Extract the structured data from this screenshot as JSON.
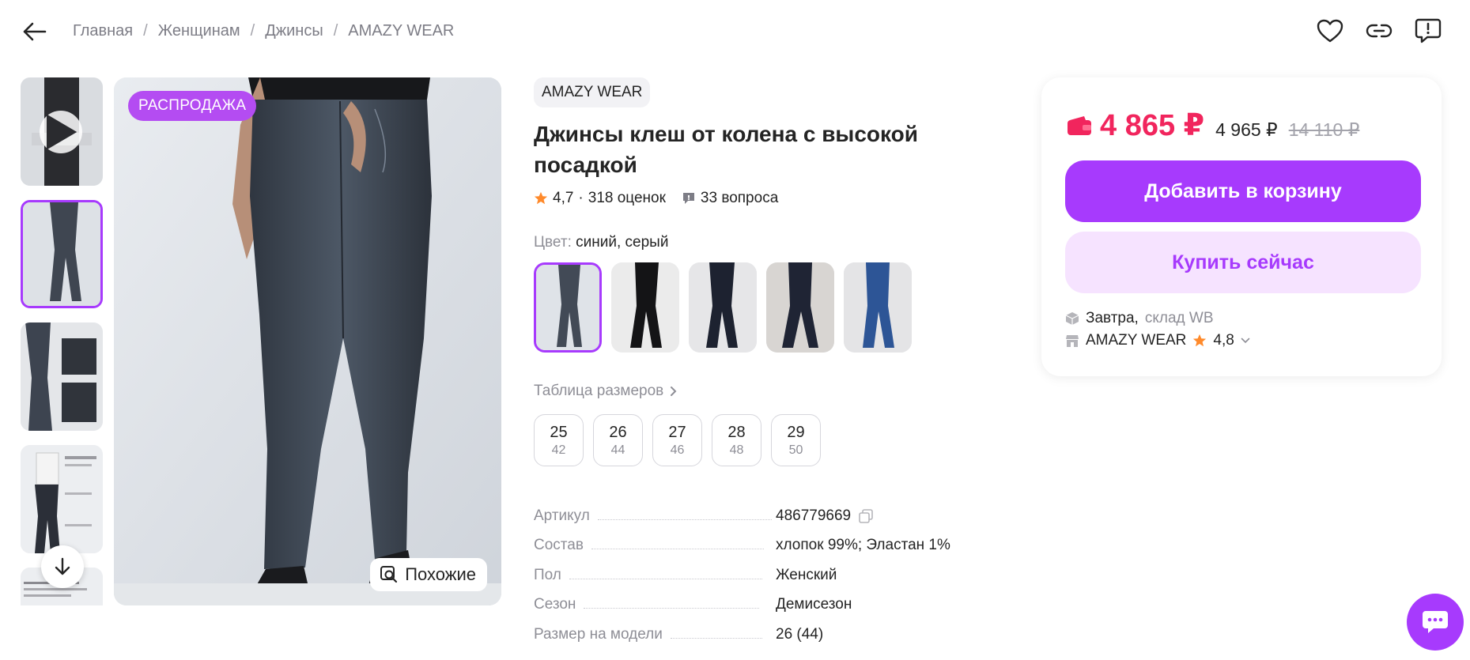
{
  "breadcrumb": {
    "items": [
      "Главная",
      "Женщинам",
      "Джинсы",
      "AMAZY WEAR"
    ],
    "separator": "/"
  },
  "icons": {
    "back": "arrow-left-icon",
    "favorite": "heart-icon",
    "share": "link-icon",
    "report": "report-icon",
    "play": "play-icon",
    "scroll_down": "arrow-down-icon",
    "similar": "similar-search-icon",
    "star": "star-icon",
    "questions": "chat-bubble-icon",
    "wallet": "wallet-icon",
    "copy": "copy-icon",
    "warehouse": "box-icon",
    "store": "store-icon",
    "chevron": "chevron-right-icon",
    "chat": "support-chat-icon"
  },
  "gallery": {
    "badge": "РАСПРОДАЖА",
    "similar_label": "Похожие"
  },
  "product": {
    "brand": "AMAZY WEAR",
    "title": "Джинсы клеш от колена с высокой посадкой",
    "rating": "4,7",
    "reviews": "318 оценок",
    "rating_sep": "·",
    "questions": "33 вопроса",
    "color_label": "Цвет:",
    "color_value": "синий, серый",
    "size_table_label": "Таблица размеров",
    "sizes": [
      {
        "ru": "25",
        "intl": "42"
      },
      {
        "ru": "26",
        "intl": "44"
      },
      {
        "ru": "27",
        "intl": "46"
      },
      {
        "ru": "28",
        "intl": "48"
      },
      {
        "ru": "29",
        "intl": "50"
      }
    ],
    "params": [
      {
        "key": "Артикул",
        "value": "486779669"
      },
      {
        "key": "Состав",
        "value": "хлопок 99%; Эластан 1%"
      },
      {
        "key": "Пол",
        "value": "Женский"
      },
      {
        "key": "Сезон",
        "value": "Демисезон"
      },
      {
        "key": "Размер на модели",
        "value": "26 (44)"
      }
    ]
  },
  "buy": {
    "price": "4 865 ₽",
    "price_old1": "4 965 ₽",
    "price_old2": "14 110 ₽",
    "add_to_cart": "Добавить в корзину",
    "buy_now": "Купить сейчас",
    "delivery_day": "Завтра,",
    "delivery_from": "склад WB",
    "seller_name": "AMAZY WEAR",
    "seller_rating": "4,8"
  },
  "colors": {
    "accent": "#a73afd",
    "price": "#f1255d",
    "badge": "#b44cf2",
    "star": "#ff8a2b"
  }
}
